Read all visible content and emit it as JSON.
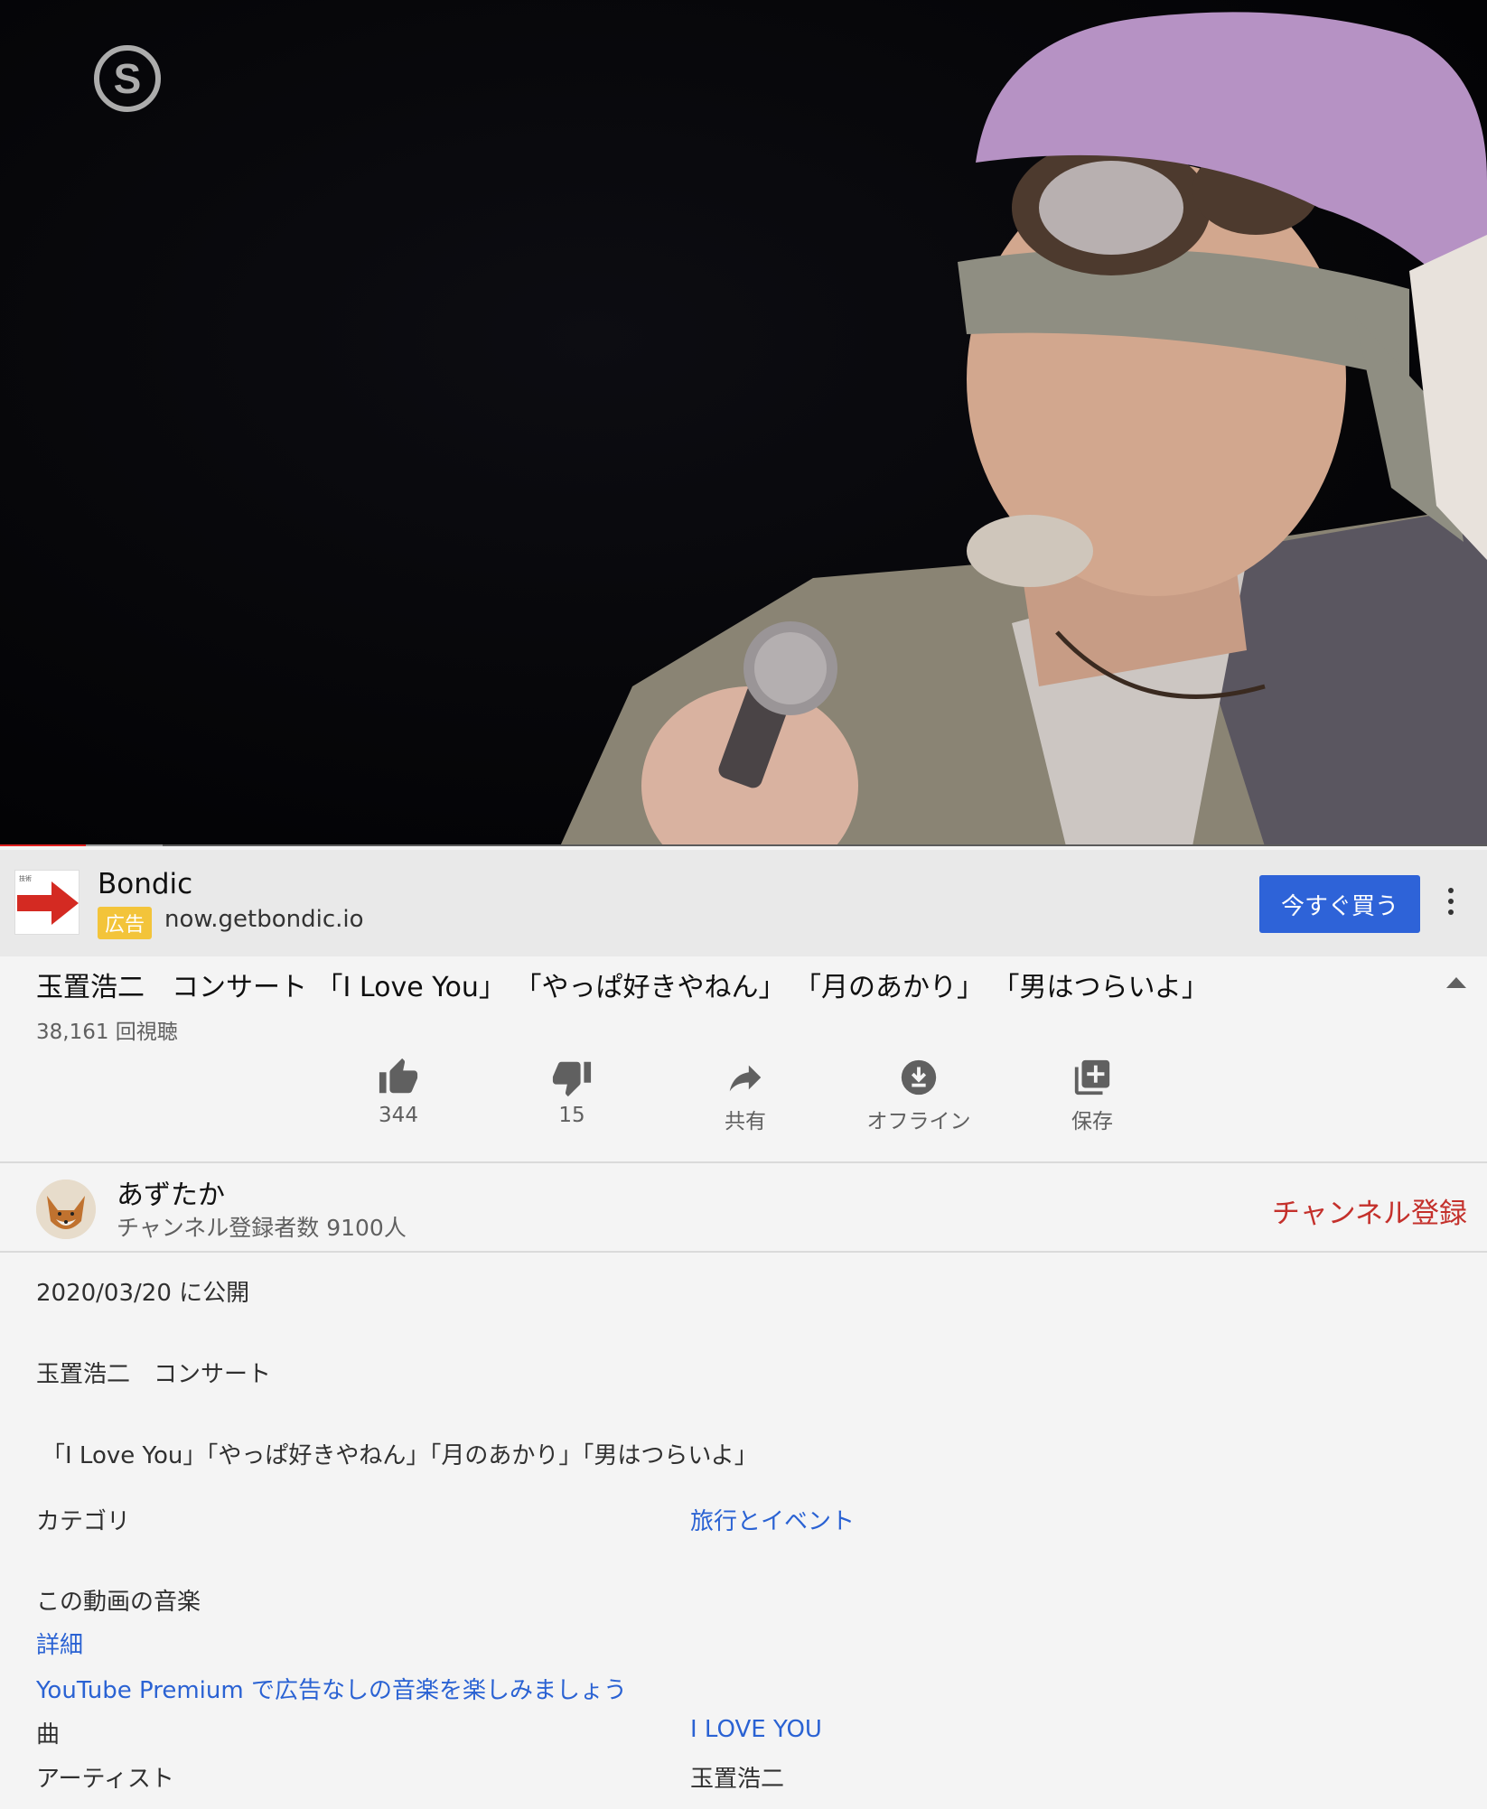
{
  "video": {
    "watermark_letter": "S"
  },
  "ad": {
    "advertiser": "Bondic",
    "badge": "広告",
    "url": "now.getbondic.io",
    "cta": "今すぐ買う",
    "logo_small_text": "技術"
  },
  "video_info": {
    "title": "玉置浩二　コンサート 「I Love You」 「やっぱ好きやねん」 「月のあかり」 「男はつらいよ」",
    "views": "38,161 回視聴"
  },
  "actions": {
    "like": "344",
    "dislike": "15",
    "share": "共有",
    "offline": "オフライン",
    "save": "保存"
  },
  "channel": {
    "name": "あずたか",
    "subscribers": "チャンネル登録者数 9100人",
    "subscribe": "チャンネル登録"
  },
  "description": {
    "published": "2020/03/20 に公開",
    "line1": "玉置浩二　コンサート",
    "line2": "「I Love You」「やっぱ好きやねん」「月のあかり」「男はつらいよ」",
    "category_label": "カテゴリ",
    "category_value": "旅行とイベント",
    "music_heading": "この動画の音楽",
    "details_link": "詳細",
    "premium_link": "YouTube Premium で広告なしの音楽を楽しみましょう",
    "song_label": "曲",
    "song_value": "I LOVE YOU",
    "artist_label": "アーティスト",
    "artist_value": "玉置浩二"
  },
  "colors": {
    "accent_blue": "#2e63d8",
    "link_blue": "#2a62d3",
    "subscribe_red": "#c4302b",
    "progress_red": "#e02020",
    "badge_yellow": "#f3c43a"
  }
}
